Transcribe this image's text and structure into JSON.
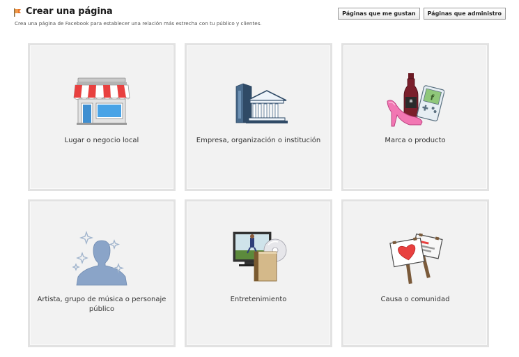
{
  "header": {
    "title": "Crear una página",
    "subtitle": "Crea una página de Facebook para establecer una relación más estrecha con tu público y clientes."
  },
  "buttons": {
    "liked_pages": "Páginas que me gustan",
    "admin_pages": "Páginas que administro"
  },
  "categories": [
    {
      "label": "Lugar o negocio local",
      "icon": "storefront-icon"
    },
    {
      "label": "Empresa, organización o institución",
      "icon": "buildings-icon"
    },
    {
      "label": "Marca o producto",
      "icon": "products-icon"
    },
    {
      "label": "Artista, grupo de música o personaje público",
      "icon": "artist-silhouette-icon"
    },
    {
      "label": "Entretenimiento",
      "icon": "entertainment-icon"
    },
    {
      "label": "Causa o comunidad",
      "icon": "protest-signs-icon"
    }
  ],
  "colors": {
    "card_bg": "#f2f2f2",
    "card_border": "#e2e2e2",
    "awning_red": "#e8403f",
    "building_blue": "#4a6b8c"
  }
}
